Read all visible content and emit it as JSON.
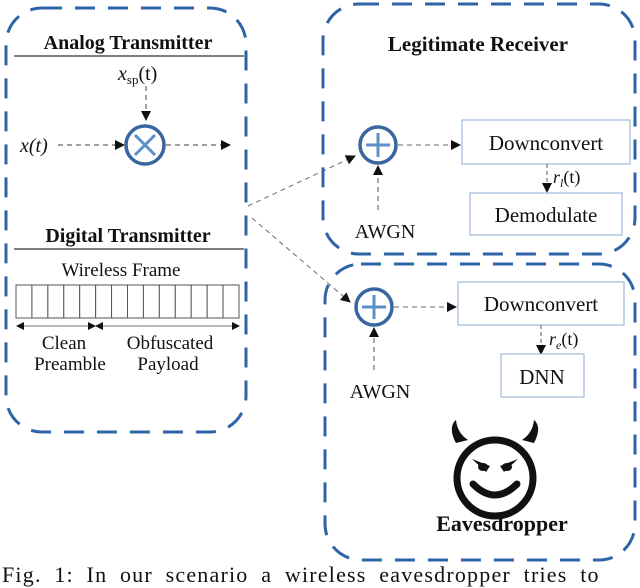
{
  "analog_transmitter": {
    "title": "Analog Transmitter",
    "input_signal": "x(t)",
    "spread_signal_base": "x",
    "spread_signal_sub": "sp",
    "spread_signal_tail": "(t)",
    "mixer_symbol": "×"
  },
  "digital_transmitter": {
    "title": "Digital Transmitter",
    "frame_label": "Wireless Frame",
    "frame_cells": 14,
    "preamble_cells": 5,
    "preamble_label_line1": "Clean",
    "preamble_label_line2": "Preamble",
    "payload_label_line1": "Obfuscated",
    "payload_label_line2": "Payload"
  },
  "legitimate_receiver": {
    "title": "Legitimate Receiver",
    "adder_symbol": "+",
    "noise_label": "AWGN",
    "block1": "Downconvert",
    "signal_base": "r",
    "signal_sub": "l",
    "signal_tail": "(t)",
    "block2": "Demodulate"
  },
  "eavesdropper": {
    "title": "Eavesdropper",
    "adder_symbol": "+",
    "noise_label": "AWGN",
    "block1": "Downconvert",
    "signal_base": "r",
    "signal_sub": "e",
    "signal_tail": "(t)",
    "block2": "DNN",
    "icon": "devil-face-icon"
  },
  "colors": {
    "frame_border": "#2e63a8",
    "circle": "#3a66a0",
    "circle_glyph": "#5b8fc9",
    "block_border": "#9fbbdc",
    "arrow": "#111111"
  },
  "caption": "Fig. 1: In our scenario a wireless eavesdropper tries to"
}
